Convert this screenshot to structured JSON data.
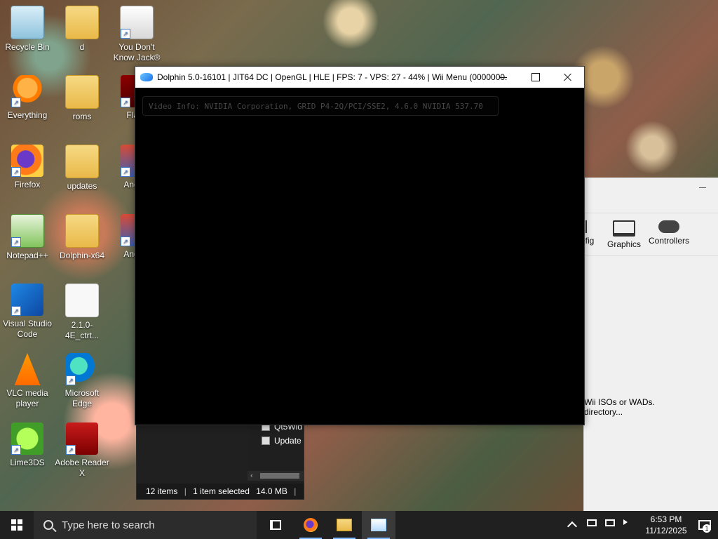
{
  "desktop": {
    "icons": [
      {
        "label": "Recycle Bin"
      },
      {
        "label": "d"
      },
      {
        "label": "You Don't Know Jack®"
      },
      {
        "label": "Everything"
      },
      {
        "label": "roms"
      },
      {
        "label": "Flash"
      },
      {
        "label": "Firefox"
      },
      {
        "label": "updates"
      },
      {
        "label": "Angr R"
      },
      {
        "label": "Notepad++"
      },
      {
        "label": "Dolphin-x64"
      },
      {
        "label": "Angr R"
      },
      {
        "label": "Visual Studio Code"
      },
      {
        "label": "2.1.0-4E_ctrt..."
      },
      {
        "label": "VLC media player"
      },
      {
        "label": "Microsoft Edge"
      },
      {
        "label": "Lime3DS"
      },
      {
        "label": "Adobe Reader X"
      }
    ]
  },
  "dolphin_main": {
    "toolbar": {
      "config_label": "fig",
      "graphics_label": "Graphics",
      "controllers_label": "Controllers"
    },
    "grid_message": "Wii ISOs or WADs.\ndirectory..."
  },
  "explorer": {
    "files": [
      {
        "name": "Qt5Wid"
      },
      {
        "name": "Update"
      }
    ],
    "status": {
      "items": "12 items",
      "selected": "1 item selected",
      "size": "14.0 MB"
    }
  },
  "game_window": {
    "title": "Dolphin 5.0-16101 | JIT64 DC | OpenGL | HLE | FPS: 7 - VPS: 27 - 44% | Wii Menu (0000000...",
    "video_info": "Video Info: NVIDIA Corporation, GRID P4-2Q/PCI/SSE2, 4.6.0 NVIDIA 537.70"
  },
  "taskbar": {
    "search_placeholder": "Type here to search",
    "time": "6:53 PM",
    "date": "11/12/2025",
    "notification_count": "1"
  }
}
